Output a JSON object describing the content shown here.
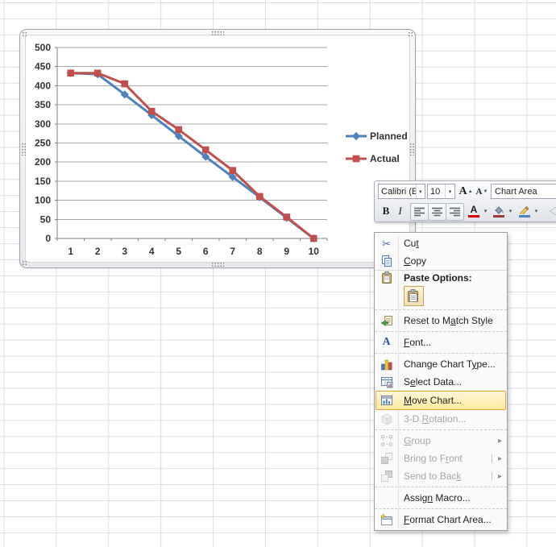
{
  "colors": {
    "series_planned": "#4F81BD",
    "series_actual": "#C0504D",
    "menu_highlight_border": "#E8A33D",
    "menu_highlight_fill": "#FFEBA6",
    "excel_gridline": "#D9DEE6",
    "chart_gridline": "#A6A6A6",
    "font_color_bar": "#E00000",
    "fill_color_bar": "#9C3A38",
    "outline_color_bar": "#4F81BD"
  },
  "chart_data": {
    "type": "line",
    "x": [
      1,
      2,
      3,
      4,
      5,
      6,
      7,
      8,
      9,
      10
    ],
    "xlabels": [
      "1",
      "2",
      "3",
      "4",
      "5",
      "6",
      "7",
      "8",
      "9",
      "10"
    ],
    "series": [
      {
        "name": "Planned",
        "color": "#4F81BD",
        "marker": "diamond",
        "values": [
          433,
          430,
          377,
          323,
          268,
          214,
          161,
          108,
          54,
          0
        ]
      },
      {
        "name": "Actual",
        "color": "#C0504D",
        "marker": "square",
        "values": [
          433,
          433,
          405,
          333,
          285,
          232,
          178,
          110,
          56,
          0
        ]
      }
    ],
    "title": "",
    "xlabel": "",
    "ylabel": "",
    "ylim": [
      0,
      500
    ],
    "ytick": 50,
    "grid": "horizontal",
    "legend_position": "right",
    "legend_labels": [
      "Planned",
      "Actual"
    ]
  },
  "mini_toolbar": {
    "font_name": "Calibri (E",
    "font_size": "10",
    "grow_font_label": "A",
    "shrink_font_label": "A",
    "element_selector": "Chart Area",
    "bold_label": "B",
    "italic_label": "I",
    "icons": [
      "grow-font-icon",
      "shrink-font-icon",
      "align-left-icon",
      "align-center-icon",
      "align-right-icon",
      "font-color-icon",
      "fill-color-icon",
      "outline-color-icon",
      "brush-icon"
    ]
  },
  "context_menu": {
    "items": [
      {
        "id": "cut",
        "label": "Cut",
        "accel_index": 2,
        "icon": "scissors"
      },
      {
        "id": "copy",
        "label": "Copy",
        "accel_index": 0,
        "icon": "copy"
      },
      {
        "type": "sep",
        "style": "solid"
      },
      {
        "type": "heading",
        "id": "paste-options",
        "label": "Paste Options:",
        "icon": "clipboard"
      },
      {
        "type": "thumb",
        "id": "paste-option-button",
        "icon": "paste-thumb"
      },
      {
        "type": "sep",
        "style": "dashed"
      },
      {
        "id": "reset-to-match-style",
        "label": "Reset to Match Style",
        "accel_index": 10,
        "icon": "reset"
      },
      {
        "type": "sep",
        "style": "dashed"
      },
      {
        "id": "font",
        "label": "Font...",
        "accel_index": 0,
        "icon": "font"
      },
      {
        "type": "sep",
        "style": "dashed"
      },
      {
        "id": "change-chart-type",
        "label": "Change Chart Type...",
        "accel_index": 14,
        "icon": "chart-type"
      },
      {
        "id": "select-data",
        "label": "Select Data...",
        "accel_index": 1,
        "icon": "select-data"
      },
      {
        "id": "move-chart",
        "label": "Move Chart...",
        "accel_index": 0,
        "icon": "move-chart",
        "highlighted": true,
        "tall": true
      },
      {
        "id": "3d-rotation",
        "label": "3-D Rotation...",
        "accel_index": 4,
        "icon": "cube",
        "disabled": true
      },
      {
        "type": "sep",
        "style": "dashed"
      },
      {
        "id": "group",
        "label": "Group",
        "accel_index": 0,
        "icon": "group",
        "disabled": true,
        "submenu": "plain"
      },
      {
        "id": "bring-to-front",
        "label": "Bring to Front",
        "accel_index": 10,
        "icon": "bring-front",
        "disabled": true,
        "submenu": "split"
      },
      {
        "id": "send-to-back",
        "label": "Send to Back",
        "accel_index": 11,
        "icon": "send-back",
        "disabled": true,
        "submenu": "split"
      },
      {
        "type": "sep",
        "style": "dashed"
      },
      {
        "id": "assign-macro",
        "label": "Assign Macro...",
        "accel_index": 5,
        "icon": "none"
      },
      {
        "type": "sep",
        "style": "dashed"
      },
      {
        "id": "format-chart-area",
        "label": "Format Chart Area...",
        "accel_index": 0,
        "icon": "format-area"
      }
    ]
  }
}
